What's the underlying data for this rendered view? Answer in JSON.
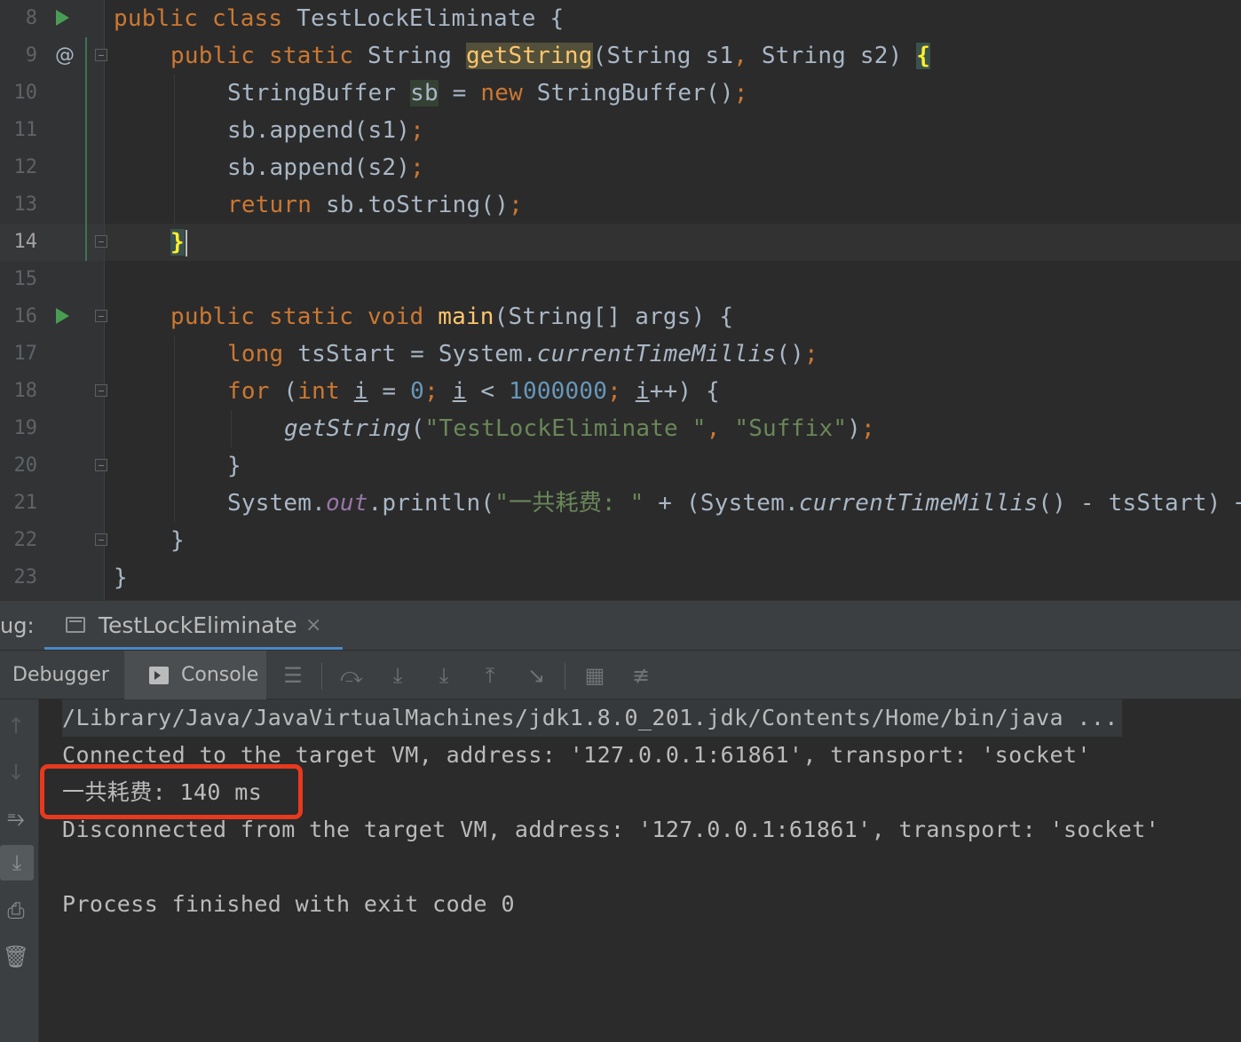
{
  "editor": {
    "line_numbers": [
      "8",
      "9",
      "10",
      "11",
      "12",
      "13",
      "14",
      "15",
      "16",
      "17",
      "18",
      "19",
      "20",
      "21",
      "22",
      "23"
    ],
    "code": {
      "l8": [
        "public ",
        "class ",
        "TestLockEliminate {"
      ],
      "l9": [
        "public ",
        "static ",
        "String ",
        "getString",
        "(String s1",
        ", ",
        "String s2) ",
        "{"
      ],
      "l10": [
        "StringBuffer ",
        "sb",
        " = ",
        "new ",
        "StringBuffer()",
        ";"
      ],
      "l11": [
        "sb.append(s1)",
        ";"
      ],
      "l12": [
        "sb.append(s2)",
        ";"
      ],
      "l13": [
        "return ",
        "sb.toString()",
        ";"
      ],
      "l14": [
        "}"
      ],
      "l16": [
        "public ",
        "static ",
        "void ",
        "main",
        "(String[] args) {"
      ],
      "l17": [
        "long ",
        "tsStart = System.",
        "currentTimeMillis",
        "()",
        ";"
      ],
      "l18": [
        "for ",
        "(",
        "int ",
        "i",
        " = ",
        "0",
        "; ",
        "i",
        " < ",
        "1000000",
        "; ",
        "i",
        "++) {"
      ],
      "l19": [
        "getString",
        "(",
        "\"TestLockEliminate \"",
        ", ",
        "\"Suffix\"",
        ")",
        ";"
      ],
      "l20": [
        "}"
      ],
      "l21": [
        "System.",
        "out",
        ".println(",
        "\"一共耗费: \"",
        " + (System.",
        "currentTimeMillis",
        "() - tsStart) +"
      ],
      "l22": [
        "}"
      ],
      "l23": [
        "}"
      ]
    }
  },
  "debug": {
    "title": "ug:",
    "session_tab": "TestLockEliminate",
    "close_glyph": "×",
    "tabs": {
      "debugger": "Debugger",
      "console": "Console"
    }
  },
  "console": {
    "lines": [
      "/Library/Java/JavaVirtualMachines/jdk1.8.0_201.jdk/Contents/Home/bin/java ...",
      "Connected to the target VM, address: '127.0.0.1:61861', transport: 'socket'",
      "一共耗费: 140 ms",
      "Disconnected from the target VM, address: '127.0.0.1:61861', transport: 'socket'",
      "",
      "Process finished with exit code 0"
    ]
  },
  "colors": {
    "keyword": "#cc7832",
    "method": "#ffc66d",
    "string": "#6a8759",
    "number": "#6897bb",
    "field": "#9876aa",
    "highlight_box": "#e8391e",
    "tab_underline": "#4a88c7"
  },
  "icons": {
    "gutter": [
      "run-icon",
      "override-icon",
      "fold-icon"
    ],
    "toolbar": [
      "menu-icon",
      "step-over-icon",
      "step-into-icon",
      "force-step-into-icon",
      "step-out-icon",
      "run-to-cursor-icon",
      "evaluate-expression-icon",
      "trace-icon"
    ],
    "side": [
      "up-arrow-icon",
      "down-arrow-icon",
      "soft-wrap-icon",
      "scroll-to-end-icon",
      "print-icon",
      "trash-icon"
    ]
  }
}
